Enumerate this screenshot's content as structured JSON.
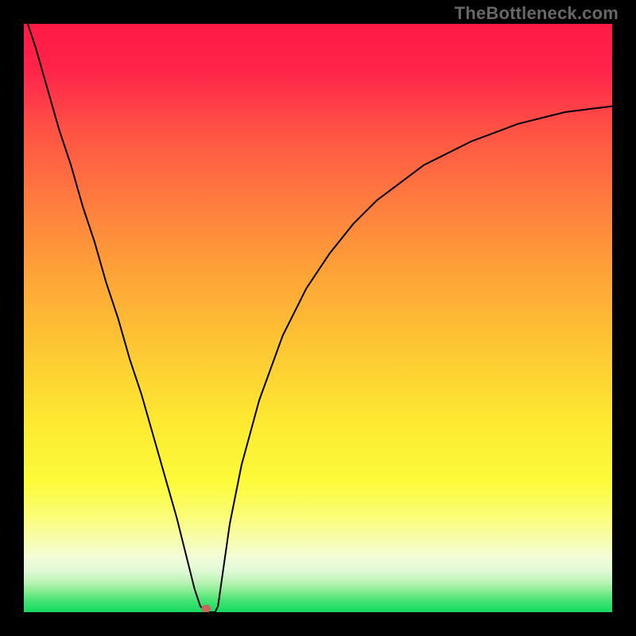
{
  "watermark": "TheBottleneck.com",
  "chart_data": {
    "type": "line",
    "title": "",
    "xlabel": "",
    "ylabel": "",
    "xlim": [
      0,
      100
    ],
    "ylim": [
      0,
      100
    ],
    "grid": false,
    "legend": false,
    "background_gradient": {
      "stops": [
        {
          "offset": 0.0,
          "color": "#ff1a46"
        },
        {
          "offset": 0.08,
          "color": "#ff244a"
        },
        {
          "offset": 0.18,
          "color": "#ff5245"
        },
        {
          "offset": 0.3,
          "color": "#ff7b3f"
        },
        {
          "offset": 0.42,
          "color": "#fea238"
        },
        {
          "offset": 0.55,
          "color": "#fdc733"
        },
        {
          "offset": 0.68,
          "color": "#fdea31"
        },
        {
          "offset": 0.78,
          "color": "#fcfb3a"
        },
        {
          "offset": 0.84,
          "color": "#fbfd7a"
        },
        {
          "offset": 0.88,
          "color": "#f7fdb3"
        },
        {
          "offset": 0.905,
          "color": "#f3fcd7"
        },
        {
          "offset": 0.93,
          "color": "#e0f9d6"
        },
        {
          "offset": 0.95,
          "color": "#b7f3b3"
        },
        {
          "offset": 0.965,
          "color": "#84ec90"
        },
        {
          "offset": 0.98,
          "color": "#49e374"
        },
        {
          "offset": 1.0,
          "color": "#12db60"
        }
      ]
    },
    "series": [
      {
        "name": "bottleneck-curve",
        "color": "#000000",
        "stroke_width": 2,
        "x": [
          0,
          2,
          4,
          6,
          8,
          10,
          12,
          14,
          16,
          18,
          20,
          22,
          24,
          26,
          27,
          28,
          29,
          30,
          31,
          32,
          32.5,
          33,
          34,
          35,
          37,
          40,
          44,
          48,
          52,
          56,
          60,
          64,
          68,
          72,
          76,
          80,
          84,
          88,
          92,
          96,
          100
        ],
        "y": [
          102,
          96,
          89,
          82,
          76,
          69,
          63,
          56,
          50,
          43,
          37,
          30,
          23,
          16,
          12,
          8,
          4,
          1,
          0,
          0,
          0,
          1,
          8,
          15,
          25,
          36,
          47,
          55,
          61,
          66,
          70,
          73,
          76,
          78,
          80,
          81.5,
          83,
          84,
          85,
          85.5,
          86
        ]
      }
    ],
    "marker": {
      "name": "optimal-point",
      "x": 31.0,
      "y": 0.6,
      "rx": 6,
      "ry": 5,
      "color": "#c6685d"
    }
  }
}
